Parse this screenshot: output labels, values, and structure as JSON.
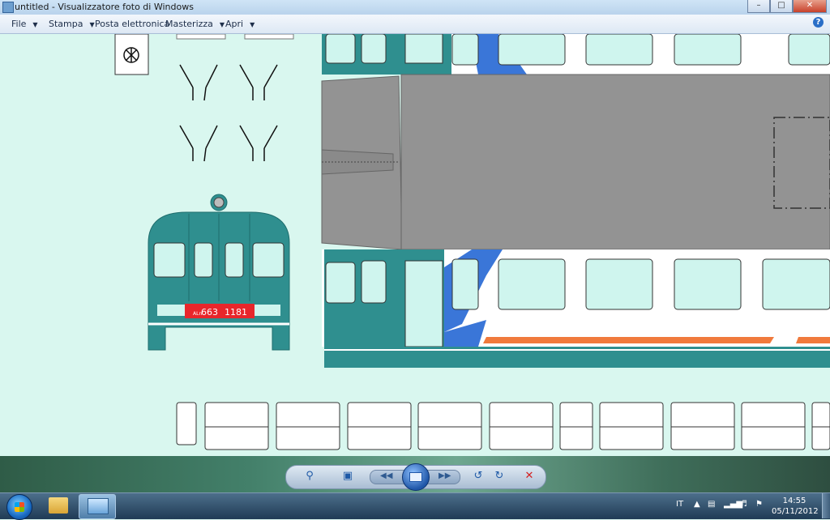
{
  "window": {
    "title": "untitled - Visualizzatore foto di Windows",
    "buttons": [
      "minimize-icon",
      "maximize-icon",
      "close-icon"
    ]
  },
  "menubar": {
    "items": [
      {
        "label": "File"
      },
      {
        "label": "Stampa"
      },
      {
        "label": "Posta elettronica"
      },
      {
        "label": "Masterizza"
      },
      {
        "label": "Apri"
      }
    ],
    "help_icon": "help-icon"
  },
  "image": {
    "plate_text": "663",
    "plate_number": "1181",
    "plate_prefix": "ALn",
    "colors": {
      "background": "#d9f7ef",
      "body": "#2f8f8f",
      "roof": "#939393",
      "window": "#cff5ee",
      "stripe_blue": "#3a76d8",
      "stripe_orange": "#f07a3c",
      "plate": "#e8262b"
    }
  },
  "viewer_toolbar": {
    "icons": [
      "zoom-icon",
      "actual-size-icon",
      "previous-icon",
      "slideshow-icon",
      "next-icon",
      "rotate-left-icon",
      "rotate-right-icon",
      "delete-icon"
    ]
  },
  "taskbar": {
    "language": "IT",
    "time": "14:55",
    "date": "05/11/2012"
  }
}
